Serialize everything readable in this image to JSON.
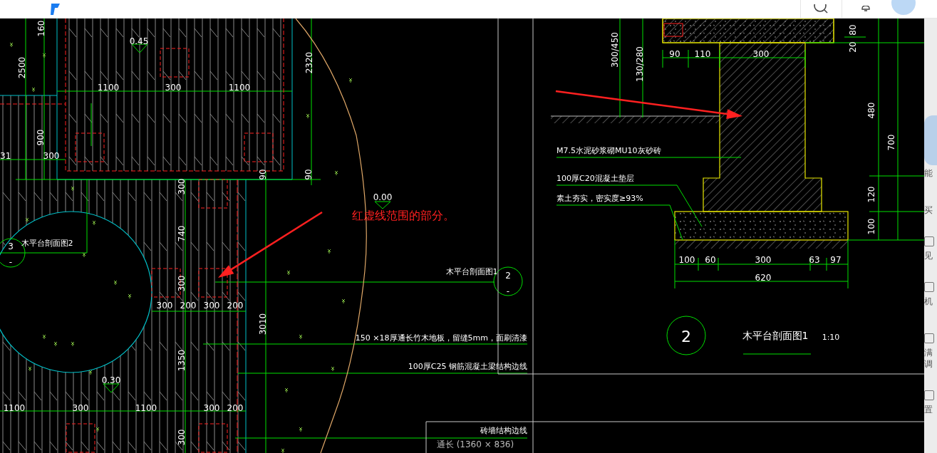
{
  "drawing": {
    "texts": [
      {
        "kind": "dimension",
        "text": "160"
      },
      {
        "kind": "dimension",
        "text": "2500"
      },
      {
        "kind": "elevation",
        "text": "0.45"
      },
      {
        "kind": "dimension",
        "text": "2320"
      },
      {
        "kind": "dimension",
        "text": "1100"
      },
      {
        "kind": "dimension",
        "text": "300"
      },
      {
        "kind": "dimension",
        "text": "1100"
      },
      {
        "kind": "dimension",
        "text": "900"
      },
      {
        "kind": "dimension",
        "text": "31"
      },
      {
        "kind": "dimension",
        "text": "300"
      },
      {
        "kind": "dimension",
        "text": "90"
      },
      {
        "kind": "dimension",
        "text": "90"
      },
      {
        "kind": "dimension",
        "text": "300"
      },
      {
        "kind": "dimension",
        "text": "740"
      },
      {
        "kind": "dimension",
        "text": "300"
      },
      {
        "kind": "dimension",
        "text": "300"
      },
      {
        "kind": "dimension",
        "text": "200"
      },
      {
        "kind": "dimension",
        "text": "300"
      },
      {
        "kind": "dimension",
        "text": "200"
      },
      {
        "kind": "dimension",
        "text": "3010"
      },
      {
        "kind": "dimension",
        "text": "1350"
      },
      {
        "kind": "elevation",
        "text": "0.30"
      },
      {
        "kind": "dimension",
        "text": "1100"
      },
      {
        "kind": "dimension",
        "text": "300"
      },
      {
        "kind": "dimension",
        "text": "1100"
      },
      {
        "kind": "dimension",
        "text": "300"
      },
      {
        "kind": "dimension",
        "text": "200"
      },
      {
        "kind": "dimension",
        "text": "300"
      },
      {
        "kind": "note",
        "text": "木平台剖面图2"
      },
      {
        "kind": "callout",
        "text": "3"
      },
      {
        "kind": "callout",
        "text": "-"
      },
      {
        "kind": "elevation",
        "text": "0.00"
      },
      {
        "kind": "annotation",
        "text": "红虚线范围的部分。"
      },
      {
        "kind": "note",
        "text": "木平台剖面图1"
      },
      {
        "kind": "callout",
        "text": "2"
      },
      {
        "kind": "callout",
        "text": "-"
      },
      {
        "kind": "note",
        "text": "150 ×18厚通长竹木地板，留缝5mm，面刷清漆"
      },
      {
        "kind": "note",
        "text": "100厚C25 钢筋混凝土梁结构边线"
      },
      {
        "kind": "note",
        "text": "砖墙结构边线"
      },
      {
        "kind": "dimension",
        "text": "300/450"
      },
      {
        "kind": "dimension",
        "text": "130/280"
      },
      {
        "kind": "dimension",
        "text": "90"
      },
      {
        "kind": "dimension",
        "text": "110"
      },
      {
        "kind": "dimension",
        "text": "300"
      },
      {
        "kind": "dimension",
        "text": "80"
      },
      {
        "kind": "dimension",
        "text": "20"
      },
      {
        "kind": "dimension",
        "text": "480"
      },
      {
        "kind": "dimension",
        "text": "700"
      },
      {
        "kind": "dimension",
        "text": "120"
      },
      {
        "kind": "dimension",
        "text": "100"
      },
      {
        "kind": "note",
        "text": "M7.5水泥砂浆砌MU10灰砂砖"
      },
      {
        "kind": "note",
        "text": "100厚C20混凝土垫层"
      },
      {
        "kind": "note",
        "text": "素土夯实，密实度≥93%"
      },
      {
        "kind": "dimension",
        "text": "100"
      },
      {
        "kind": "dimension",
        "text": "60"
      },
      {
        "kind": "dimension",
        "text": "300"
      },
      {
        "kind": "dimension",
        "text": "63"
      },
      {
        "kind": "dimension",
        "text": "97"
      },
      {
        "kind": "dimension",
        "text": "620"
      },
      {
        "kind": "callout",
        "text": "2"
      },
      {
        "kind": "title",
        "text": "木平台剖面图1"
      },
      {
        "kind": "scale",
        "text": "1:10"
      }
    ],
    "size_caption": "通长 (1360 × 836)"
  },
  "side_panel": {
    "items": [
      {
        "label": "能"
      },
      {
        "label": "买"
      },
      {
        "label": "见"
      },
      {
        "label": "机"
      },
      {
        "label": "满"
      },
      {
        "label": "调"
      },
      {
        "label": "置"
      }
    ]
  }
}
